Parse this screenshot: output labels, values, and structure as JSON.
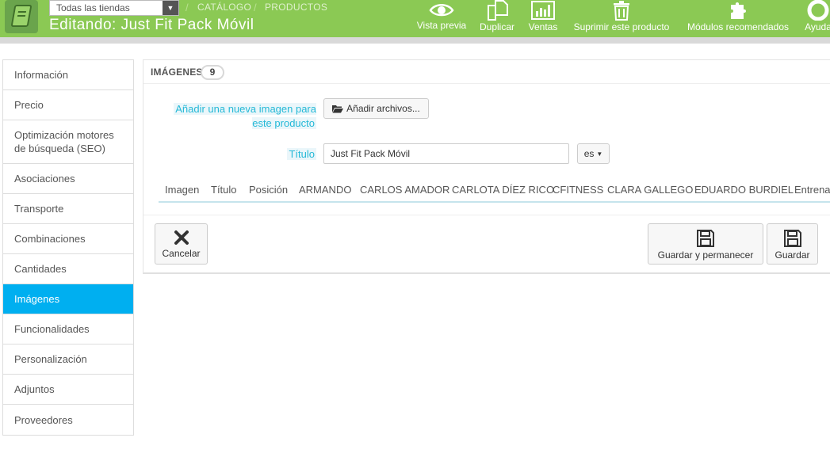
{
  "header": {
    "shop_selector": "Todas las tiendas",
    "breadcrumb": [
      "CATÁLOGO",
      "PRODUCTOS"
    ],
    "title": "Editando: Just Fit Pack Móvil",
    "toolbar": [
      {
        "label": "Vista previa",
        "icon": "eye-icon"
      },
      {
        "label": "Duplicar",
        "icon": "copy-icon"
      },
      {
        "label": "Ventas",
        "icon": "bar-chart-icon"
      },
      {
        "label": "Suprimir este producto",
        "icon": "trash-icon"
      },
      {
        "label": "Módulos recomendados",
        "icon": "puzzle-icon"
      },
      {
        "label": "Ayuda",
        "icon": "lifebuoy-icon"
      }
    ]
  },
  "sidebar": {
    "items": [
      {
        "label": "Información"
      },
      {
        "label": "Precio"
      },
      {
        "label": "Optimización motores de búsqueda (SEO)"
      },
      {
        "label": "Asociaciones"
      },
      {
        "label": "Transporte"
      },
      {
        "label": "Combinaciones"
      },
      {
        "label": "Cantidades"
      },
      {
        "label": "Imágenes",
        "active": true
      },
      {
        "label": "Funcionalidades"
      },
      {
        "label": "Personalización"
      },
      {
        "label": "Adjuntos"
      },
      {
        "label": "Proveedores"
      }
    ]
  },
  "images_panel": {
    "title": "IMÁGENES",
    "count": "9",
    "add_image_label": "Añadir una nueva imagen para este producto",
    "add_files_button": "Añadir archivos...",
    "title_label": "Título",
    "title_value": "Just Fit Pack Móvil",
    "language": "es",
    "columns": [
      "Imagen",
      "Título",
      "Posición",
      "ARMANDO",
      "CARLOS AMADOR",
      "CARLOTA DÍEZ RICO",
      "CFITNESS",
      "CLARA GALLEGO",
      "EDUARDO BURDIEL",
      "Entrenad"
    ]
  },
  "actions": {
    "cancel": "Cancelar",
    "save_stay": "Guardar y permanecer",
    "save": "Guardar"
  },
  "colors": {
    "header_green": "#8bc954",
    "active_blue": "#00aff0",
    "label_blue": "#25b9d7"
  }
}
